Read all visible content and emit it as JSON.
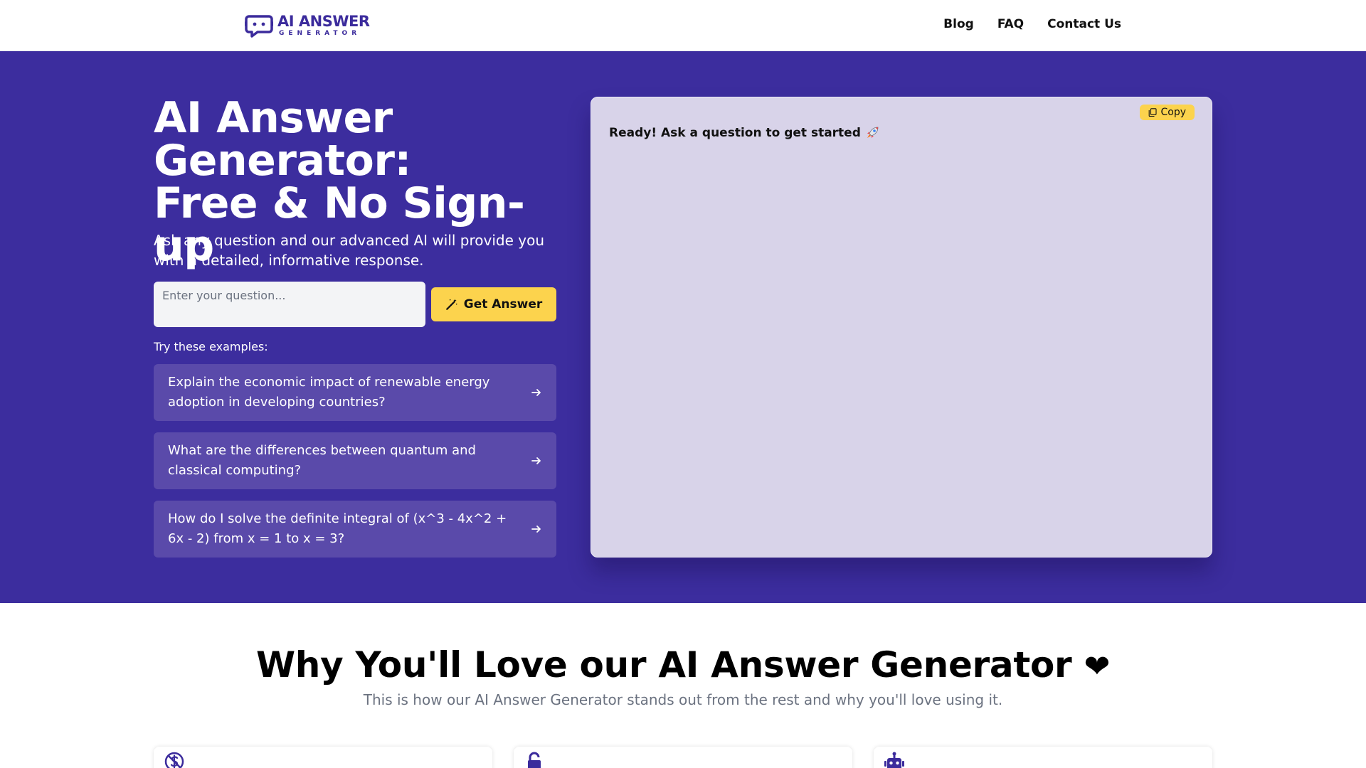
{
  "header": {
    "logo_line1": "AI ANSWER",
    "logo_line2": "GENERATOR",
    "nav": [
      {
        "label": "Blog"
      },
      {
        "label": "FAQ"
      },
      {
        "label": "Contact Us"
      }
    ]
  },
  "hero": {
    "title_lines": [
      "AI Answer",
      "Generator:",
      "Free & No Sign-up"
    ],
    "subtitle": "Ask any question and our advanced AI will provide you with a detailed, informative response.",
    "input_placeholder": "Enter your question...",
    "button_label": "Get Answer",
    "try_label": "Try these examples:",
    "examples": [
      {
        "text": "Explain the economic impact of renewable energy adoption in developing countries?"
      },
      {
        "text": "What are the differences between quantum and classical computing?"
      },
      {
        "text": "How do I solve the definite integral of (x^3 - 4x^2 + 6x - 2) from x = 1 to x = 3?"
      }
    ]
  },
  "answer": {
    "copy_label": "Copy",
    "status_text": "Ready! Ask a question to get started"
  },
  "features": {
    "title": "Why You'll Love our AI Answer Generator",
    "heart": "❤",
    "subtitle": "This is how our AI Answer Generator stands out from the rest and why you'll love using it.",
    "cards": [
      {
        "icon": "no-dollar-icon"
      },
      {
        "icon": "unlock-icon"
      },
      {
        "icon": "robot-icon"
      }
    ]
  },
  "colors": {
    "brand": "#3c2d9e",
    "accent": "#fcd34d",
    "example_bg": "#5a4aaa",
    "panel_bg": "#d8d3e9"
  }
}
